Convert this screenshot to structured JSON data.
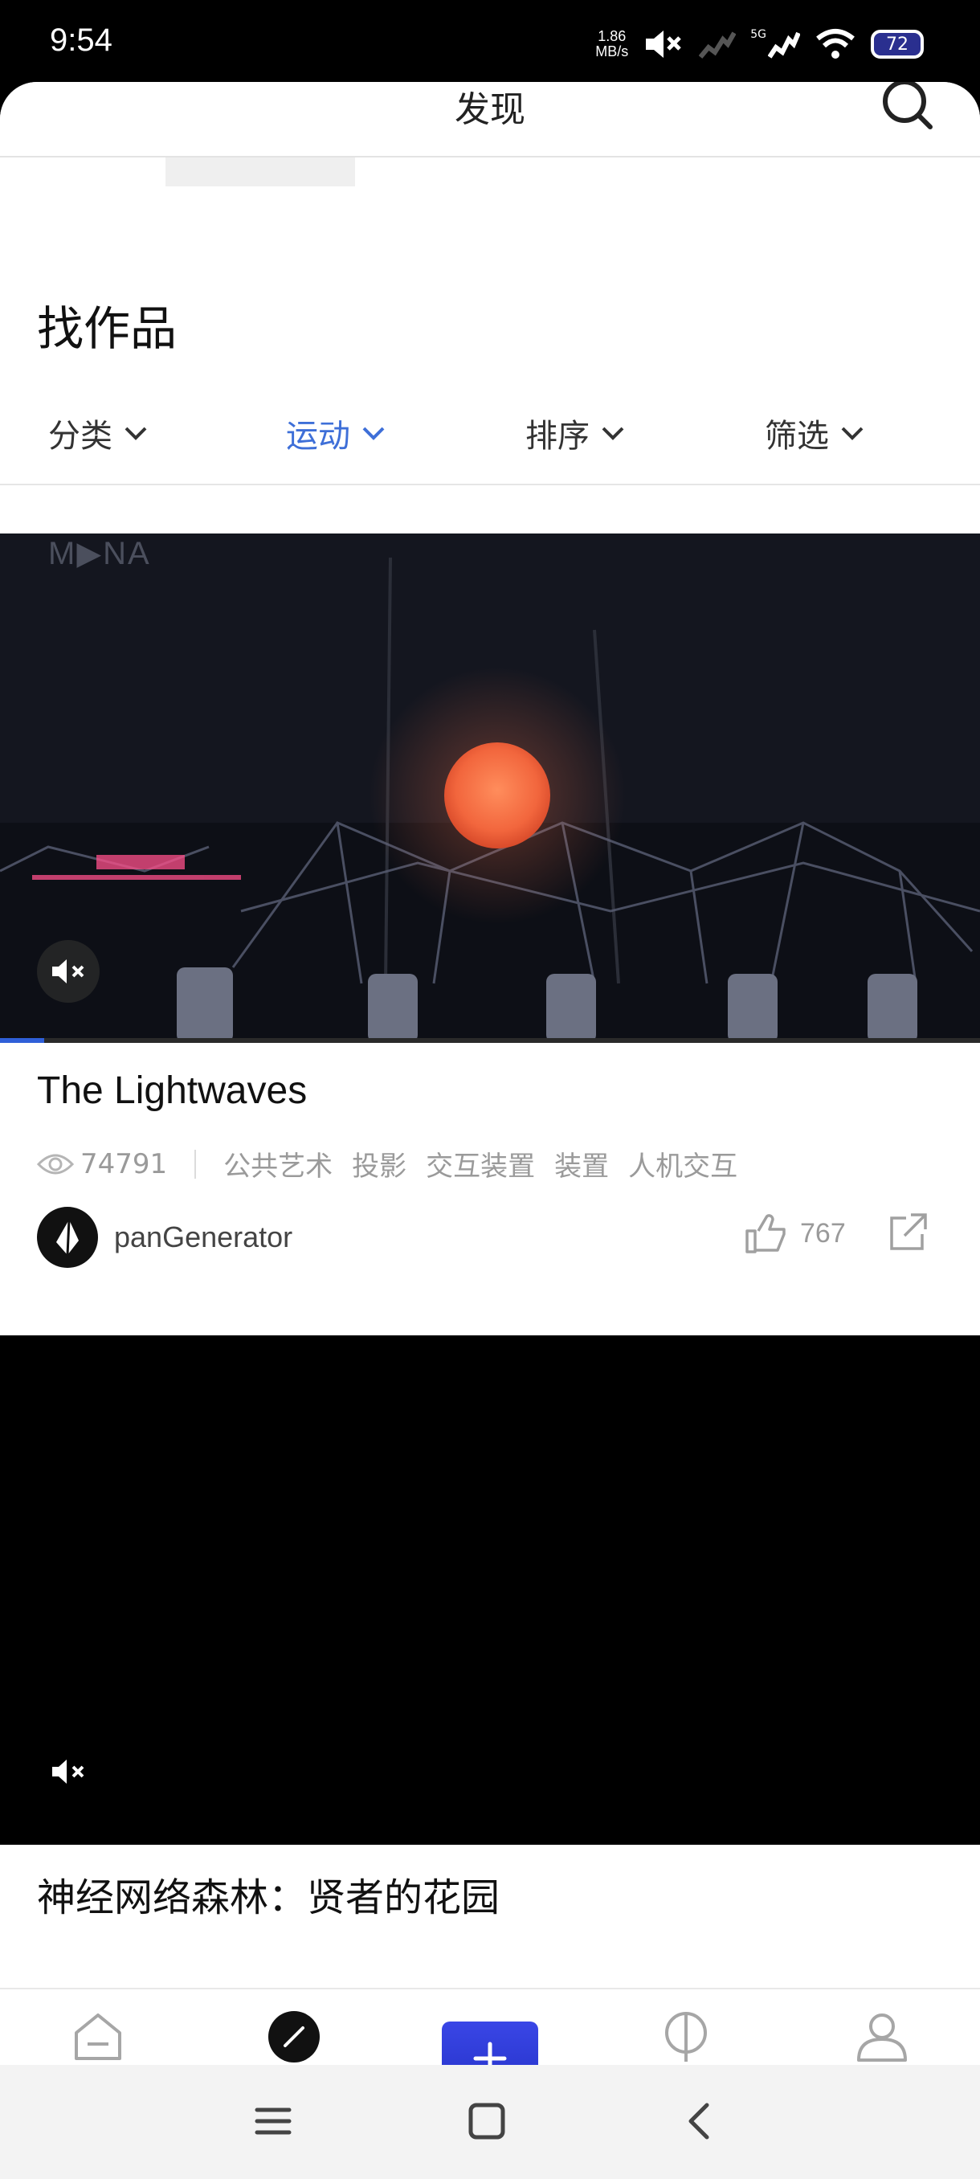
{
  "status_bar": {
    "time": "9:54",
    "speed_top": "1.86",
    "speed_bottom": "MB/s",
    "network": "5G",
    "battery": "72"
  },
  "header": {
    "title": "发现"
  },
  "section": {
    "title": "找作品"
  },
  "filters": [
    {
      "label": "分类",
      "active": false
    },
    {
      "label": "运动",
      "active": true
    },
    {
      "label": "排序",
      "active": false
    },
    {
      "label": "筛选",
      "active": false
    }
  ],
  "cards": [
    {
      "watermark": "M▶NA",
      "title": "The Lightwaves",
      "views": "74791",
      "tags": [
        "公共艺术",
        "投影",
        "交互装置",
        "装置",
        "人机交互"
      ],
      "author": "panGenerator",
      "likes": "767",
      "progress_percent": 4.5
    },
    {
      "title": "神经网络森林：贤者的花园"
    }
  ],
  "bottom_nav": [
    {
      "label": "首页",
      "active": false
    },
    {
      "label": "发现",
      "active": true
    },
    {
      "label": "线下",
      "active": false
    },
    {
      "label": "我的",
      "active": false
    }
  ],
  "colors": {
    "accent": "#3e6fd8",
    "primary_button": "#2f3ad8",
    "muted_text": "#9a9a9a"
  }
}
